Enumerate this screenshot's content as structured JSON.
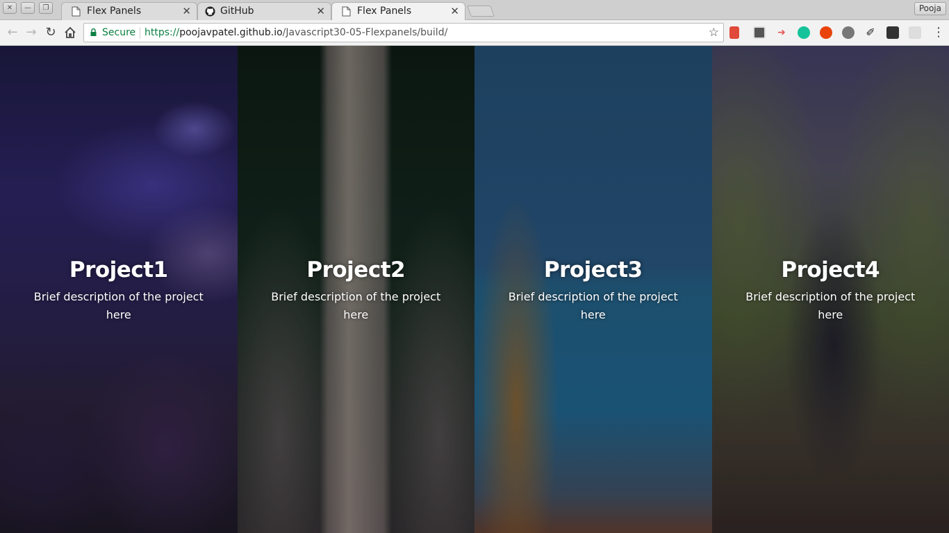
{
  "browser": {
    "tabs": [
      {
        "title": "Flex Panels",
        "icon": "page-icon",
        "active": false
      },
      {
        "title": "GitHub",
        "icon": "github-icon",
        "active": false
      },
      {
        "title": "Flex Panels",
        "icon": "page-icon",
        "active": true
      }
    ],
    "profile_name": "Pooja",
    "security_label": "Secure",
    "url": {
      "scheme": "https://",
      "host": "poojavpatel.github.io",
      "path": "/Javascript30-05-Flexpanels/build/"
    },
    "extensions": [
      "ext-red-icon",
      "ext-pocket-icon",
      "ext-arrow-icon",
      "grammarly-icon",
      "ext-infinity-icon",
      "settings-gear-icon",
      "ext-dark-icon",
      "ext-book-icon",
      "ext-grid-icon"
    ]
  },
  "panels": [
    {
      "title": "Project1",
      "description": "Brief description of the project here"
    },
    {
      "title": "Project2",
      "description": "Brief description of the project here"
    },
    {
      "title": "Project3",
      "description": "Brief description of the project here"
    },
    {
      "title": "Project4",
      "description": "Brief description of the project here"
    }
  ]
}
